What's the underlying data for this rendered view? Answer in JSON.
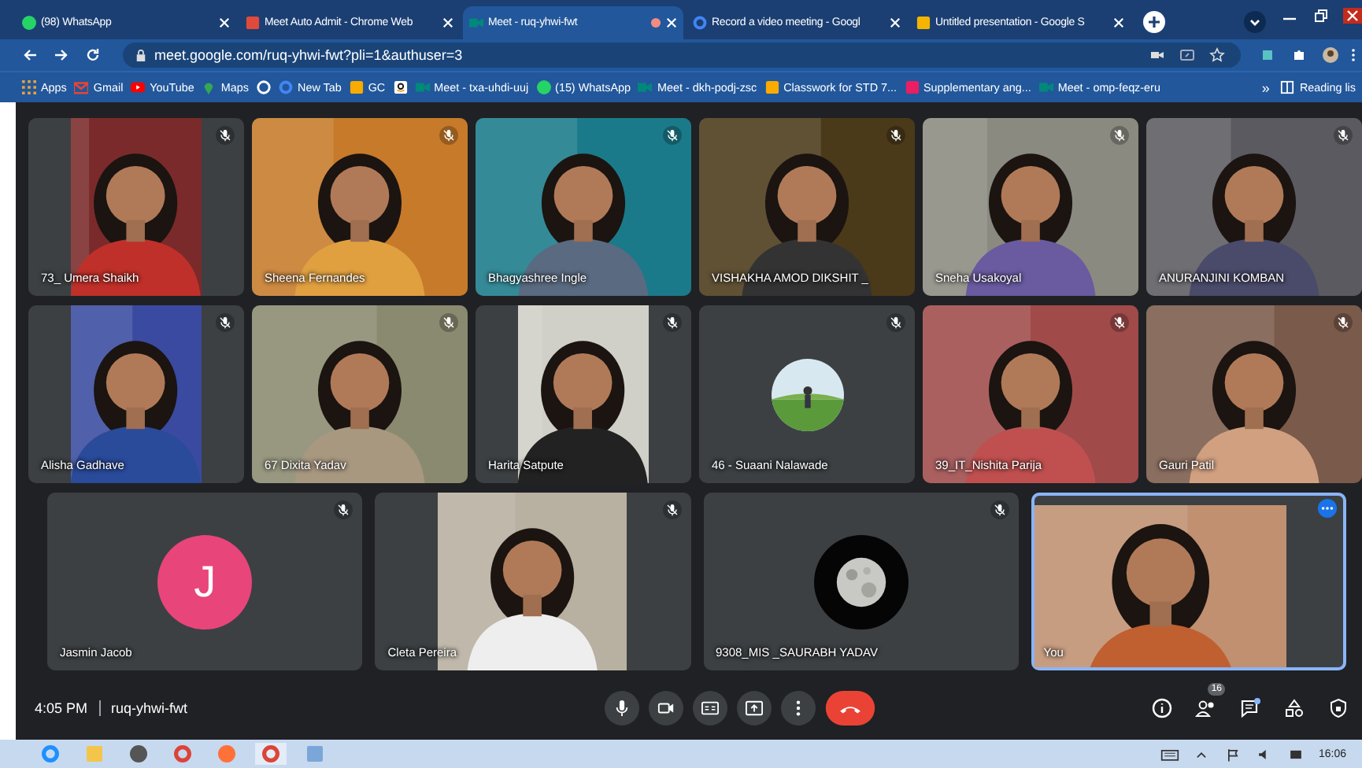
{
  "browser": {
    "tabs": [
      {
        "title": "(98) WhatsApp",
        "selected": false,
        "recording": false
      },
      {
        "title": "Meet Auto Admit - Chrome Web",
        "selected": false,
        "recording": false
      },
      {
        "title": "Meet - ruq-yhwi-fwt",
        "selected": true,
        "recording": true
      },
      {
        "title": "Record a video meeting - Googl",
        "selected": false,
        "recording": false
      },
      {
        "title": "Untitled presentation - Google S",
        "selected": false,
        "recording": false
      }
    ],
    "address": "meet.google.com/ruq-yhwi-fwt?pli=1&authuser=3",
    "bookmarks": [
      "Apps",
      "Gmail",
      "YouTube",
      "Maps",
      "New Tab",
      "GC",
      "Meet - txa-uhdi-uuj",
      "(15) WhatsApp",
      "Meet - dkh-podj-zsc",
      "Classwork for STD 7...",
      "Supplementary ang...",
      "Meet - omp-feqz-eru"
    ],
    "overflow": "»",
    "reading_list": "Reading lis"
  },
  "meet": {
    "tiles": [
      {
        "name": "73_ Umera Shaikh",
        "kind": "portrait",
        "muted": true,
        "highlighted": false
      },
      {
        "name": "Sheena Fernandes",
        "kind": "video",
        "muted": true,
        "highlighted": false
      },
      {
        "name": "Bhagyashree Ingle",
        "kind": "video",
        "muted": true,
        "highlighted": false
      },
      {
        "name": "VISHAKHA AMOD DIKSHIT _",
        "kind": "video",
        "muted": true,
        "highlighted": false
      },
      {
        "name": "Sneha Usakoyal",
        "kind": "video",
        "muted": true,
        "highlighted": false
      },
      {
        "name": "ANURANJINI KOMBAN",
        "kind": "video",
        "muted": true,
        "highlighted": false
      },
      {
        "name": "Alisha Gadhave",
        "kind": "portrait",
        "muted": true,
        "highlighted": false
      },
      {
        "name": "67 Dixita Yadav",
        "kind": "video",
        "muted": true,
        "highlighted": false
      },
      {
        "name": "Harita Satpute",
        "kind": "portrait",
        "muted": true,
        "highlighted": false
      },
      {
        "name": "46 - Suaani Nalawade",
        "kind": "avatar",
        "muted": true,
        "highlighted": false
      },
      {
        "name": "39_IT_Nishita Parija",
        "kind": "video",
        "muted": true,
        "highlighted": false
      },
      {
        "name": "Gauri Patil",
        "kind": "video",
        "muted": true,
        "highlighted": false
      },
      {
        "name": "Jasmin Jacob",
        "kind": "initial",
        "initial": "J",
        "muted": true,
        "highlighted": false
      },
      {
        "name": "Cleta Pereira",
        "kind": "portrait",
        "muted": true,
        "highlighted": false
      },
      {
        "name": "9308_MIS _SAURABH YADAV",
        "kind": "avatar",
        "muted": true,
        "highlighted": false
      },
      {
        "name": "You",
        "kind": "video",
        "muted": false,
        "highlighted": true
      }
    ],
    "time": "4:05 PM",
    "code": "ruq-yhwi-fwt",
    "participants": "16",
    "chat_unread": true
  },
  "taskbar": {
    "apps": [
      {
        "selected": false
      },
      {
        "selected": false
      },
      {
        "selected": false
      },
      {
        "selected": false
      },
      {
        "selected": false
      },
      {
        "selected": true
      },
      {
        "selected": false
      }
    ],
    "clock": "16:06"
  }
}
